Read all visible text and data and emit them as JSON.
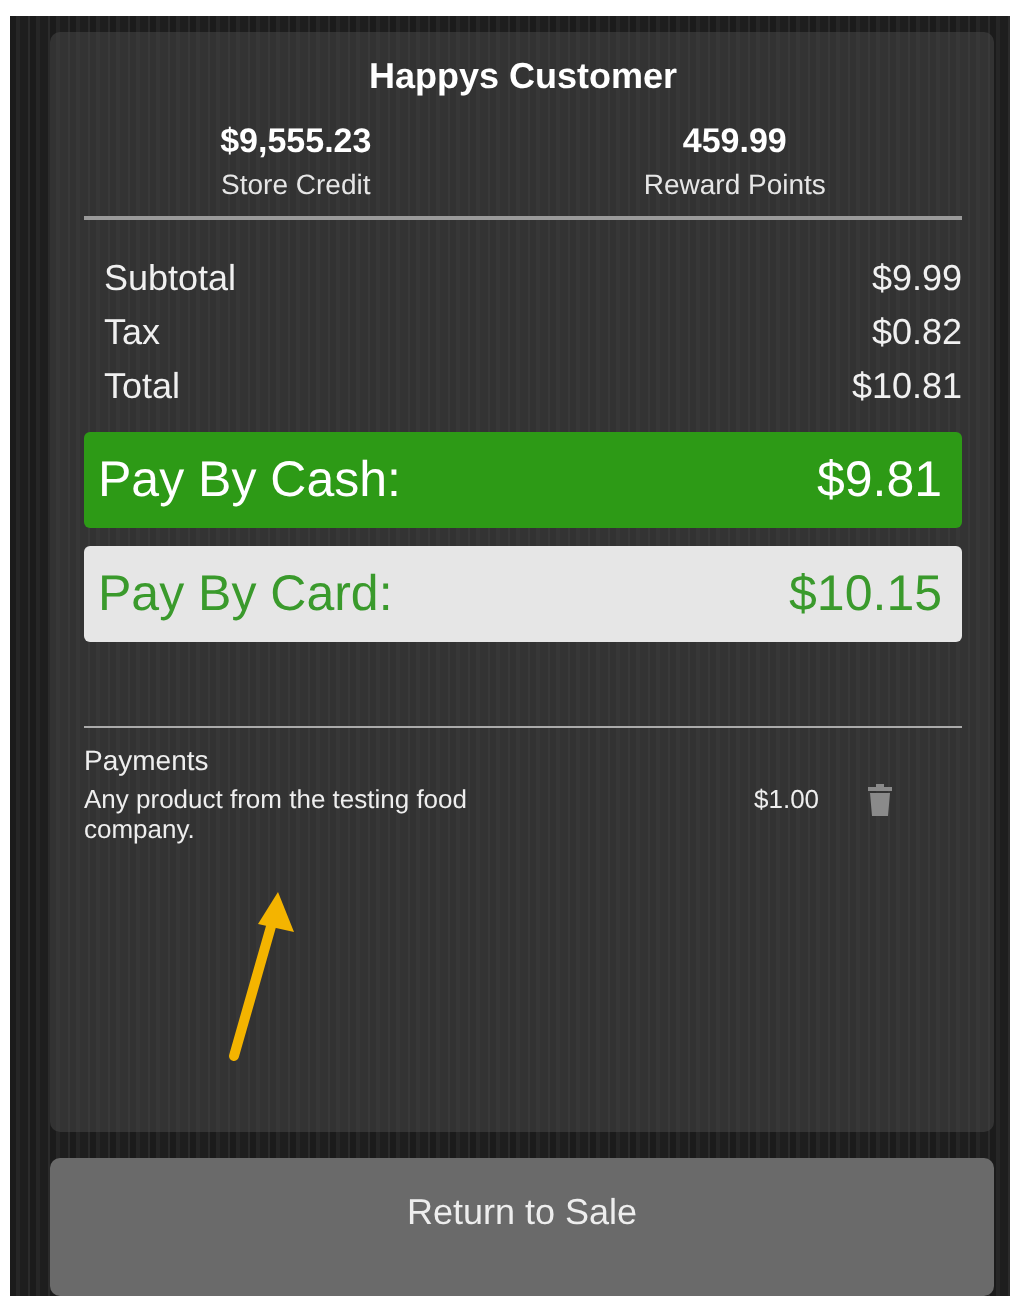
{
  "customer": {
    "name": "Happys Customer"
  },
  "stats": [
    {
      "value": "$9,555.23",
      "label": "Store Credit"
    },
    {
      "value": "459.99",
      "label": "Reward Points"
    }
  ],
  "totals": [
    {
      "label": "Subtotal",
      "amount": "$9.99"
    },
    {
      "label": "Tax",
      "amount": "$0.82"
    },
    {
      "label": "Total",
      "amount": "$10.81"
    }
  ],
  "pay_options": [
    {
      "label": "Pay By Cash:",
      "amount": "$9.81",
      "selected": true
    },
    {
      "label": "Pay By Card:",
      "amount": "$10.15",
      "selected": false
    }
  ],
  "payments": {
    "title": "Payments",
    "items": [
      {
        "description": "Any product from the testing food company.",
        "amount": "$1.00"
      }
    ]
  },
  "return_button": {
    "label": "Return to Sale"
  }
}
